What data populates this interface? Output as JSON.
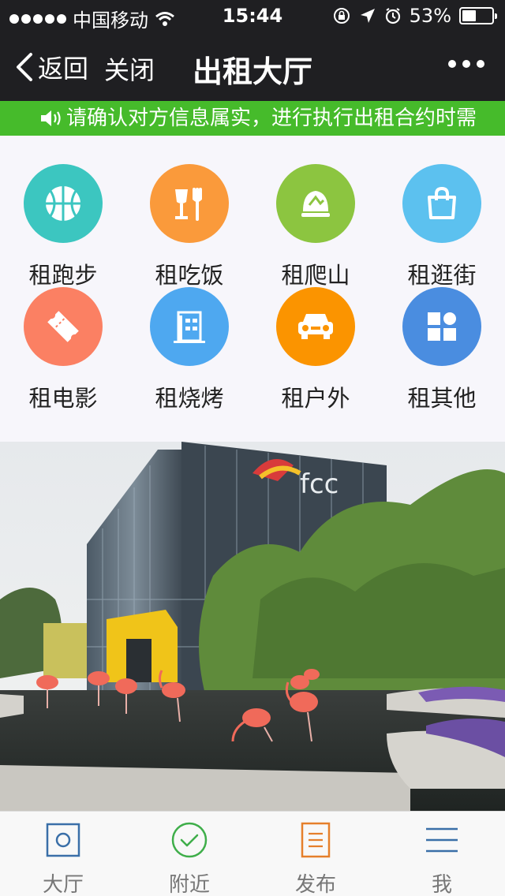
{
  "status_bar": {
    "carrier": "中国移动",
    "time": "15:44",
    "battery": "53%",
    "battery_level": 0.53
  },
  "nav": {
    "back_label": "返回",
    "close_label": "关闭",
    "title": "出租大厅"
  },
  "notice": {
    "text": "请确认对方信息属实，进行执行出租合约时需"
  },
  "categories": [
    {
      "label": "租跑步",
      "icon": "basketball-icon",
      "color": "#3cc6c0"
    },
    {
      "label": "租吃饭",
      "icon": "utensils-icon",
      "color": "#fa9a3b"
    },
    {
      "label": "租爬山",
      "icon": "mountain-icon",
      "color": "#8cc540"
    },
    {
      "label": "租逛街",
      "icon": "shopping-bag-icon",
      "color": "#5cc1ef"
    },
    {
      "label": "租电影",
      "icon": "ticket-icon",
      "color": "#fb8063"
    },
    {
      "label": "租烧烤",
      "icon": "building-icon",
      "color": "#4ea8f0"
    },
    {
      "label": "租户外",
      "icon": "car-icon",
      "color": "#fb9400"
    },
    {
      "label": "租其他",
      "icon": "grid-icon",
      "color": "#4a8de0"
    }
  ],
  "banner": {
    "sign_text": "fcc"
  },
  "tabs": [
    {
      "label": "大厅",
      "icon": "hall-icon"
    },
    {
      "label": "附近",
      "icon": "check-circle-icon"
    },
    {
      "label": "发布",
      "icon": "document-icon"
    },
    {
      "label": "我",
      "icon": "menu-icon"
    }
  ]
}
